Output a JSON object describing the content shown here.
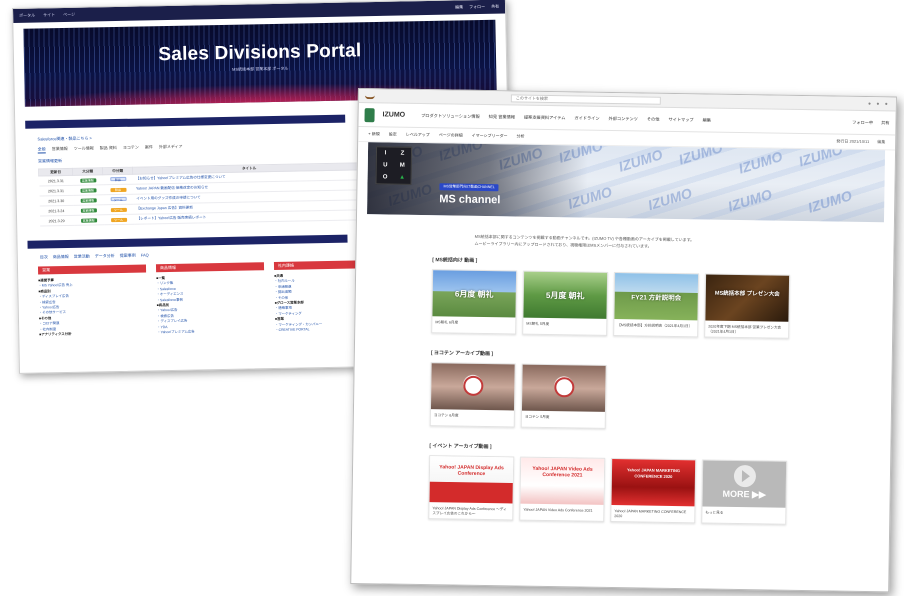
{
  "portal": {
    "topbar_links": [
      "ポータル",
      "サイト",
      "ページ"
    ],
    "topbar_right": [
      "編集",
      "フォロー",
      "共有"
    ],
    "banner_title": "Sales Divisions Portal",
    "banner_subtitle": "MS統括本部 営業本部 ポータル",
    "section_link": "Salesforce関連・製品こちら >",
    "tabs": [
      "全般",
      "営業情報",
      "ツール情報",
      "製品 資料",
      "ヨコテン",
      "案件",
      "外部メディア"
    ],
    "subhead": "営業情報更新",
    "table_headers": [
      "更新日",
      "大分類",
      "中分類",
      "タイトル"
    ],
    "table_rows": [
      {
        "date": "2021.3.31",
        "cat1": "営業情報",
        "cat2": "製品",
        "title": "【お知らせ】Yahoo!プレミアム広告の仕様変更について"
      },
      {
        "date": "2021.3.31",
        "cat1": "営業情報",
        "cat2": "製品",
        "title": "Yahoo! JAPAN 動画配信 価格改定のお知らせ"
      },
      {
        "date": "2021.3.30",
        "cat1": "営業情報",
        "cat2": "ツール",
        "title": "イベント用のグッズ作成の申請について"
      },
      {
        "date": "2021.3.24",
        "cat1": "営業情報",
        "cat2": "ツール",
        "title": "【Exchange Japan 広告】資料更新"
      },
      {
        "date": "2021.3.29",
        "cat1": "営業情報",
        "cat2": "ツール",
        "title": "【レポート】Yahoo!広告 販売実績レポート"
      }
    ],
    "nav_links": [
      "目次",
      "商品情報",
      "営業活動",
      "データ分析",
      "提案事例",
      "FAQ"
    ],
    "columns": [
      {
        "head": "営業",
        "items": [
          "■週間予算",
          "・MS Yahoo!広告 売上",
          "■商品別",
          "・ディスプレイ広告",
          "・検索広告",
          "・Yahoo!広告",
          "・その他サービス",
          "■その他",
          "・コロナ関連",
          "・社内制度",
          "■アナリティクス分析"
        ]
      },
      {
        "head": "商品情報",
        "items": [
          "■一覧",
          "・リンク集",
          "・Salesforce",
          "・オーディエンス",
          "・Salesforce事例",
          "■商品別",
          "・Yahoo!広告",
          "・検索広告",
          "・ディスプレイ広告",
          "・YDA",
          "・Yahoo!プレミアム広告"
        ]
      },
      {
        "head": "社内連絡",
        "items": [
          "■共通",
          "・社内ルール",
          "・申請関連",
          "・提出書類",
          "・その他",
          "■グロース営業本部",
          "・連絡事項",
          "・マーケティング",
          "■営業",
          "・マーケティング・カンパニー",
          "・CREATIVE PORTAL"
        ]
      }
    ]
  },
  "izumo": {
    "address": "このサイトを検索",
    "brand": "IZUMO",
    "menu": [
      "プロダクトソリューション情報",
      "知見 営業情報",
      "提案支援資料アイテム",
      "ガイドライン",
      "外部コンテンツ",
      "その他",
      "サイトマップ",
      "編集"
    ],
    "header_right": [
      "フォロー中",
      "共有"
    ],
    "cmd_items": [
      "+ 新規",
      "設定",
      "レベルアップ",
      "ページの詳細",
      "イマーシブリーダー",
      "分析"
    ],
    "cmd_right": [
      "発行日 2021/10/11",
      "編集"
    ],
    "hero": {
      "watermark": "IZUMO",
      "logo_letters": [
        "I",
        "Z",
        "U",
        "M",
        "O",
        "▲"
      ],
      "badge": "MS営業部門向け動画CHANNEL",
      "channel": "MS channel"
    },
    "intro_lines": [
      "MS統括本部に関するコンテンツを掲載する動画チャンネルです。(IZUMO TV) や各種動画のアーカイブを掲載しています。",
      "ムービーライブラリー内にアップロードされており、視聴権限はMSメンバーに付与されています。"
    ],
    "sections": [
      {
        "title": "[ MS統括向け 動画 ]",
        "cards": [
          {
            "caption": "6月度 朝礼",
            "label": "MS朝礼 6月度",
            "theme": "th-sky1"
          },
          {
            "caption": "5月度 朝礼",
            "label": "MS朝礼 5月度",
            "theme": "th-forest"
          },
          {
            "caption": "FY21 方針説明会",
            "label": "【MS統括本部】方針説明会（2021年4月1日）",
            "theme": "th-sky2"
          },
          {
            "caption": "MS統括本部 プレゼン大会",
            "label": "2020年度下期 MS統括本部 営業プレゼン大会（2021年4月1日）",
            "theme": "th-dark"
          }
        ]
      },
      {
        "title": "[ ヨコテン アーカイブ動画 ]",
        "cards": [
          {
            "caption": "",
            "label": "ヨコテン 6月度",
            "theme": "th-hands"
          },
          {
            "caption": "",
            "label": "ヨコテン 5月度",
            "theme": "th-hands"
          }
        ]
      },
      {
        "title": "[ イベント アーカイブ動画 ]",
        "cards": [
          {
            "caption": "Yahoo! JAPAN Display Ads Conference",
            "label": "Yahoo! JAPAN Display Ads Conference ～ディスプレイ広告のこれから～",
            "theme": "th-yj1"
          },
          {
            "caption": "Yahoo! JAPAN Video Ads Conference 2021",
            "label": "Yahoo! JAPAN Video Ads Conference 2021",
            "theme": "th-yj2"
          },
          {
            "caption": "Yahoo! JAPAN MARKETING CONFERENCE 2020",
            "label": "Yahoo! JAPAN MARKETING CONFERENCE 2020",
            "theme": "th-yj3"
          },
          {
            "caption": "MORE ▶▶",
            "label": "もっと見る",
            "theme": "th-more"
          }
        ]
      }
    ]
  }
}
